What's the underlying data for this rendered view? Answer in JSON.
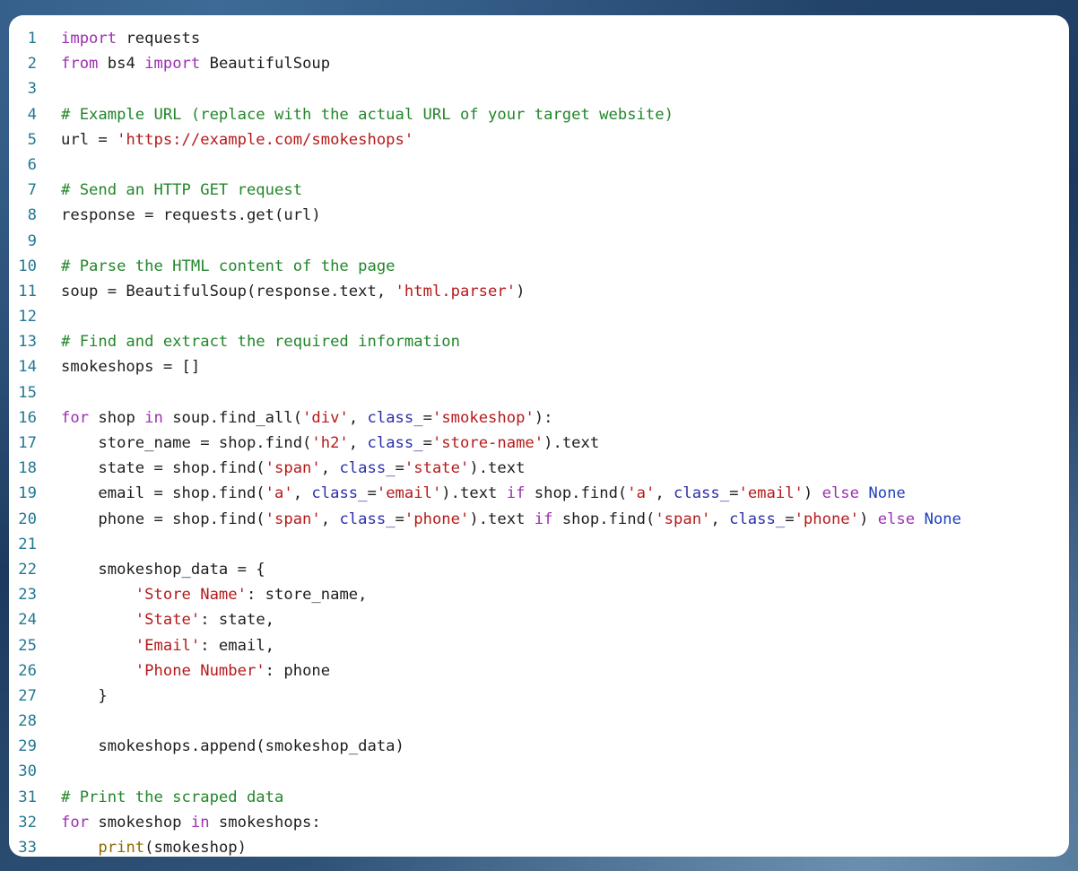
{
  "colors": {
    "keyword": "#9c2fb0",
    "string": "#b51a1a",
    "comment": "#22862a",
    "parameter": "#2a2fa8",
    "constant": "#1f3fbf",
    "builtin": "#8c6a00",
    "text": "#1e1e1e",
    "line_number": "#237893"
  },
  "code": {
    "language": "python",
    "lines": [
      {
        "n": "1",
        "tokens": [
          [
            "kw",
            "import"
          ],
          [
            "plain",
            " requests"
          ]
        ]
      },
      {
        "n": "2",
        "tokens": [
          [
            "kw",
            "from"
          ],
          [
            "plain",
            " bs4 "
          ],
          [
            "kw",
            "import"
          ],
          [
            "plain",
            " BeautifulSoup"
          ]
        ]
      },
      {
        "n": "3",
        "tokens": []
      },
      {
        "n": "4",
        "tokens": [
          [
            "cm",
            "# Example URL (replace with the actual URL of your target website)"
          ]
        ]
      },
      {
        "n": "5",
        "tokens": [
          [
            "plain",
            "url = "
          ],
          [
            "str",
            "'https://example.com/smokeshops'"
          ]
        ]
      },
      {
        "n": "6",
        "tokens": []
      },
      {
        "n": "7",
        "tokens": [
          [
            "cm",
            "# Send an HTTP GET request"
          ]
        ]
      },
      {
        "n": "8",
        "tokens": [
          [
            "plain",
            "response = requests.get(url)"
          ]
        ]
      },
      {
        "n": "9",
        "tokens": []
      },
      {
        "n": "10",
        "tokens": [
          [
            "cm",
            "# Parse the HTML content of the page"
          ]
        ]
      },
      {
        "n": "11",
        "tokens": [
          [
            "plain",
            "soup = BeautifulSoup(response.text, "
          ],
          [
            "str",
            "'html.parser'"
          ],
          [
            "plain",
            ")"
          ]
        ]
      },
      {
        "n": "12",
        "tokens": []
      },
      {
        "n": "13",
        "tokens": [
          [
            "cm",
            "# Find and extract the required information"
          ]
        ]
      },
      {
        "n": "14",
        "tokens": [
          [
            "plain",
            "smokeshops = []"
          ]
        ]
      },
      {
        "n": "15",
        "tokens": []
      },
      {
        "n": "16",
        "tokens": [
          [
            "kw",
            "for"
          ],
          [
            "plain",
            " shop "
          ],
          [
            "kw",
            "in"
          ],
          [
            "plain",
            " soup.find_all("
          ],
          [
            "str",
            "'div'"
          ],
          [
            "plain",
            ", "
          ],
          [
            "param",
            "class_"
          ],
          [
            "plain",
            "="
          ],
          [
            "str",
            "'smokeshop'"
          ],
          [
            "plain",
            "):"
          ]
        ]
      },
      {
        "n": "17",
        "tokens": [
          [
            "plain",
            "    store_name = shop.find("
          ],
          [
            "str",
            "'h2'"
          ],
          [
            "plain",
            ", "
          ],
          [
            "param",
            "class_"
          ],
          [
            "plain",
            "="
          ],
          [
            "str",
            "'store-name'"
          ],
          [
            "plain",
            ").text"
          ]
        ]
      },
      {
        "n": "18",
        "tokens": [
          [
            "plain",
            "    state = shop.find("
          ],
          [
            "str",
            "'span'"
          ],
          [
            "plain",
            ", "
          ],
          [
            "param",
            "class_"
          ],
          [
            "plain",
            "="
          ],
          [
            "str",
            "'state'"
          ],
          [
            "plain",
            ").text"
          ]
        ]
      },
      {
        "n": "19",
        "tokens": [
          [
            "plain",
            "    email = shop.find("
          ],
          [
            "str",
            "'a'"
          ],
          [
            "plain",
            ", "
          ],
          [
            "param",
            "class_"
          ],
          [
            "plain",
            "="
          ],
          [
            "str",
            "'email'"
          ],
          [
            "plain",
            ").text "
          ],
          [
            "kw",
            "if"
          ],
          [
            "plain",
            " shop.find("
          ],
          [
            "str",
            "'a'"
          ],
          [
            "plain",
            ", "
          ],
          [
            "param",
            "class_"
          ],
          [
            "plain",
            "="
          ],
          [
            "str",
            "'email'"
          ],
          [
            "plain",
            ") "
          ],
          [
            "kw",
            "else"
          ],
          [
            "plain",
            " "
          ],
          [
            "const",
            "None"
          ]
        ]
      },
      {
        "n": "20",
        "tokens": [
          [
            "plain",
            "    phone = shop.find("
          ],
          [
            "str",
            "'span'"
          ],
          [
            "plain",
            ", "
          ],
          [
            "param",
            "class_"
          ],
          [
            "plain",
            "="
          ],
          [
            "str",
            "'phone'"
          ],
          [
            "plain",
            ").text "
          ],
          [
            "kw",
            "if"
          ],
          [
            "plain",
            " shop.find("
          ],
          [
            "str",
            "'span'"
          ],
          [
            "plain",
            ", "
          ],
          [
            "param",
            "class_"
          ],
          [
            "plain",
            "="
          ],
          [
            "str",
            "'phone'"
          ],
          [
            "plain",
            ") "
          ],
          [
            "kw",
            "else"
          ],
          [
            "plain",
            " "
          ],
          [
            "const",
            "None"
          ]
        ]
      },
      {
        "n": "21",
        "tokens": []
      },
      {
        "n": "22",
        "tokens": [
          [
            "plain",
            "    smokeshop_data = {"
          ]
        ]
      },
      {
        "n": "23",
        "tokens": [
          [
            "plain",
            "        "
          ],
          [
            "str",
            "'Store Name'"
          ],
          [
            "plain",
            ": store_name,"
          ]
        ]
      },
      {
        "n": "24",
        "tokens": [
          [
            "plain",
            "        "
          ],
          [
            "str",
            "'State'"
          ],
          [
            "plain",
            ": state,"
          ]
        ]
      },
      {
        "n": "25",
        "tokens": [
          [
            "plain",
            "        "
          ],
          [
            "str",
            "'Email'"
          ],
          [
            "plain",
            ": email,"
          ]
        ]
      },
      {
        "n": "26",
        "tokens": [
          [
            "plain",
            "        "
          ],
          [
            "str",
            "'Phone Number'"
          ],
          [
            "plain",
            ": phone"
          ]
        ]
      },
      {
        "n": "27",
        "tokens": [
          [
            "plain",
            "    }"
          ]
        ]
      },
      {
        "n": "28",
        "tokens": []
      },
      {
        "n": "29",
        "tokens": [
          [
            "plain",
            "    smokeshops.append(smokeshop_data)"
          ]
        ]
      },
      {
        "n": "30",
        "tokens": []
      },
      {
        "n": "31",
        "tokens": [
          [
            "cm",
            "# Print the scraped data"
          ]
        ]
      },
      {
        "n": "32",
        "tokens": [
          [
            "kw",
            "for"
          ],
          [
            "plain",
            " smokeshop "
          ],
          [
            "kw",
            "in"
          ],
          [
            "plain",
            " smokeshops:"
          ]
        ]
      },
      {
        "n": "33",
        "tokens": [
          [
            "plain",
            "    "
          ],
          [
            "fn",
            "print"
          ],
          [
            "plain",
            "(smokeshop)"
          ]
        ]
      }
    ]
  }
}
